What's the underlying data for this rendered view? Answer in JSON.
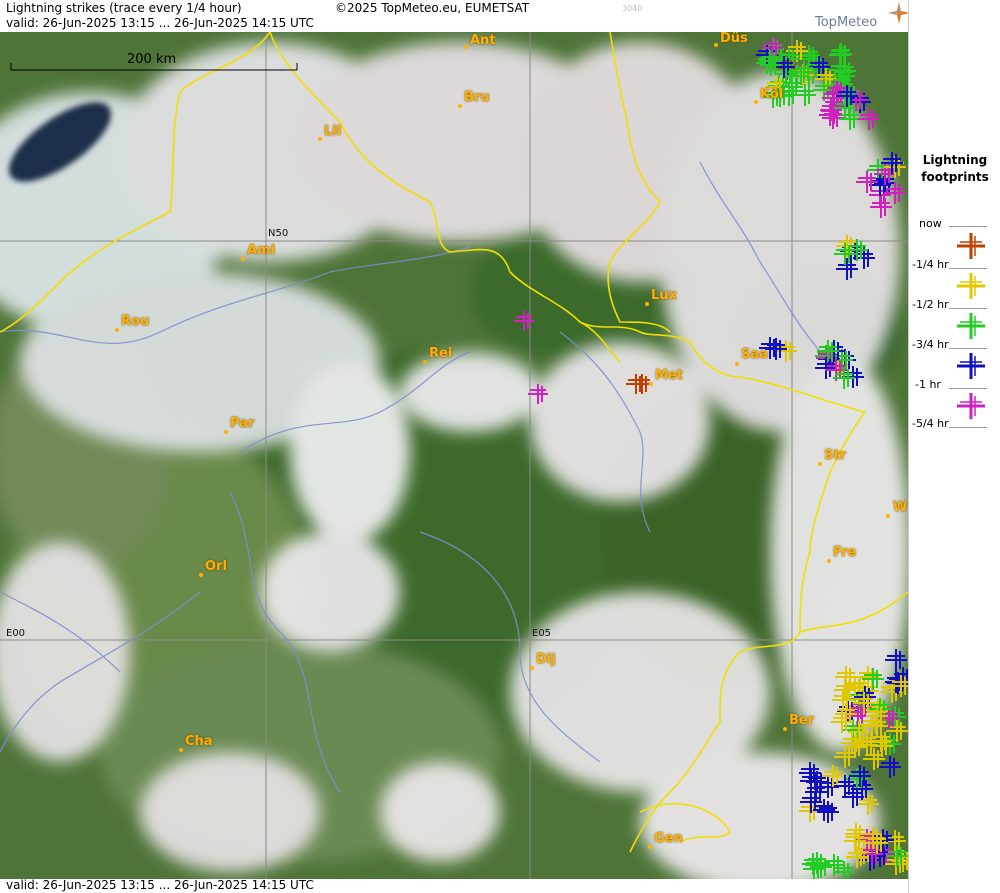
{
  "header": {
    "title": "Lightning strikes (trace every 1/4 hour)",
    "valid": "valid:  26-Jun-2025 13:15 ... 26-Jun-2025 14:15 UTC",
    "copyright": "©2025 TopMeteo.eu, EUMETSAT",
    "image_code": "3040",
    "logo": "TopMeteo"
  },
  "footer": {
    "valid": "valid:  26-Jun-2025 13:15 ... 26-Jun-2025 14:15 UTC"
  },
  "map": {
    "scale_label": "200 km",
    "grid_labels": {
      "n50": "N50",
      "e00": "E00",
      "e05": "E05"
    },
    "cities": {
      "ant": "Ant",
      "dus": "Düs",
      "bru": "Bru",
      "kol": "Köl",
      "lil": "Lil",
      "ami": "Ami",
      "rou": "Rou",
      "lux": "Lux",
      "rei": "Rei",
      "saa": "Saa",
      "met": "Met",
      "par": "Par",
      "str": "Str",
      "w": "W",
      "fre": "Fre",
      "orl": "Orl",
      "dij": "Dij",
      "ber": "Ber",
      "cha": "Cha",
      "gen": "Gen"
    }
  },
  "legend": {
    "title_line1": "Lightning",
    "title_line2": "footprints",
    "items": [
      {
        "label": "now",
        "color": "#c04000"
      },
      {
        "label": "-1/4 hr",
        "color": "#e0c800"
      },
      {
        "label": "-1/2 hr",
        "color": "#22cc22"
      },
      {
        "label": "-3/4 hr",
        "color": "#1010c0"
      },
      {
        "label": "-1 hr",
        "color": "#d020c0"
      },
      {
        "label": "-5/4 hr",
        "color": "#d020c0"
      }
    ]
  },
  "colors": {
    "border": "#f0e000",
    "river": "#7d8ed0",
    "city_label": "#ffb000",
    "now": "#c04000",
    "q1": "#e0c800",
    "q2": "#22cc22",
    "q3": "#1010c0",
    "q4": "#d020c0"
  }
}
